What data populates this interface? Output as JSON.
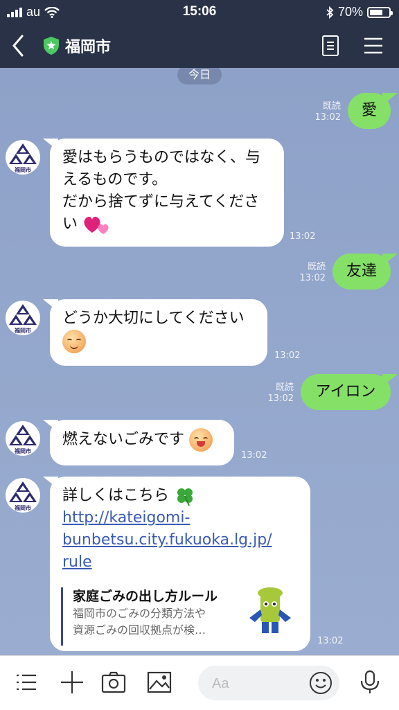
{
  "status": {
    "carrier": "au",
    "time": "15:06",
    "battery": "70%",
    "battery_level": 0.7
  },
  "header": {
    "title": "福岡市"
  },
  "chat": {
    "date_label": "今日",
    "avatar_text": "福岡市",
    "messages": [
      {
        "dir": "out",
        "read": "既読",
        "time": "13:02",
        "text": "愛"
      },
      {
        "dir": "in",
        "time": "13:02",
        "lines": [
          "愛はもらうものではなく、与",
          "えるものです。",
          "だから捨てずに与えてくださ",
          "い"
        ],
        "emoji": "pink-hearts"
      },
      {
        "dir": "out",
        "read": "既読",
        "time": "13:02",
        "text": "友達"
      },
      {
        "dir": "in",
        "time": "13:02",
        "text": "どうか大切にしてください",
        "emoji": "smiling-face"
      },
      {
        "dir": "out",
        "read": "既読",
        "time": "13:02",
        "text": "アイロン"
      },
      {
        "dir": "in",
        "time": "13:02",
        "text": "燃えないごみです",
        "emoji": "grinning-face"
      },
      {
        "dir": "in",
        "time": "13:02",
        "text": "詳しくはこちら",
        "emoji": "four-leaf-clover",
        "link_lines": [
          "http://kateigomi-",
          "bunbetsu.city.fukuoka.lg.jp/",
          "rule"
        ],
        "card": {
          "title": "家庭ごみの出し方ルール",
          "desc_lines": [
            "福岡市のごみの分類方法や",
            "資源ごみの回収拠点が検…"
          ]
        }
      }
    ]
  },
  "input": {
    "placeholder": "Aa"
  },
  "colors": {
    "header_bg": "#2a3247",
    "chat_bg": "#8fa3c9",
    "out_bubble": "#85e067",
    "in_bubble": "#ffffff",
    "shield": "#4cc764"
  }
}
